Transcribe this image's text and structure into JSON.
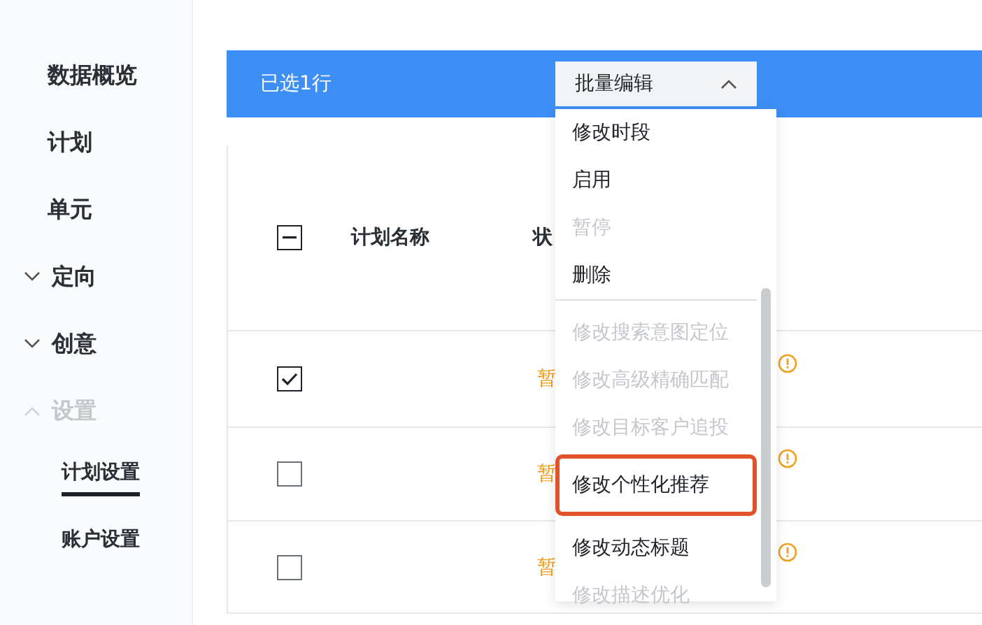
{
  "sidebar": {
    "items": [
      {
        "label": "数据概览",
        "disabled": false
      },
      {
        "label": "计划",
        "disabled": false
      },
      {
        "label": "单元",
        "disabled": false
      },
      {
        "label": "定向",
        "expanded": false,
        "disabled": false
      },
      {
        "label": "创意",
        "expanded": false,
        "disabled": false
      },
      {
        "label": "设置",
        "expanded": true,
        "disabled": true,
        "children": [
          {
            "label": "计划设置",
            "selected": true
          },
          {
            "label": "账户设置",
            "selected": false
          }
        ]
      }
    ]
  },
  "selection_bar": {
    "text": "已选1行",
    "dropdown": {
      "label": "批量编辑",
      "expanded": true
    }
  },
  "menu": {
    "groups": [
      [
        {
          "label": "修改时段",
          "disabled": false,
          "highlighted": false
        },
        {
          "label": "启用",
          "disabled": false,
          "highlighted": false
        },
        {
          "label": "暂停",
          "disabled": true,
          "highlighted": false
        },
        {
          "label": "删除",
          "disabled": false,
          "highlighted": false
        }
      ],
      [
        {
          "label": "修改搜索意图定位",
          "disabled": true,
          "highlighted": false
        },
        {
          "label": "修改高级精确匹配",
          "disabled": true,
          "highlighted": false
        },
        {
          "label": "修改目标客户追投",
          "disabled": true,
          "highlighted": false
        },
        {
          "label": "修改个性化推荐",
          "disabled": false,
          "highlighted": true
        },
        {
          "label": "修改动态标题",
          "disabled": false,
          "highlighted": false
        },
        {
          "label": "修改描述优化",
          "disabled": true,
          "highlighted": false
        }
      ]
    ]
  },
  "table": {
    "header": {
      "partially_checked": true,
      "columns": [
        "计划名称",
        "状"
      ]
    },
    "rows": [
      {
        "checked": true,
        "status": "暂",
        "warning": true
      },
      {
        "checked": false,
        "status": "暂",
        "warning": true
      },
      {
        "checked": false,
        "status": "暂",
        "warning": true
      }
    ]
  }
}
